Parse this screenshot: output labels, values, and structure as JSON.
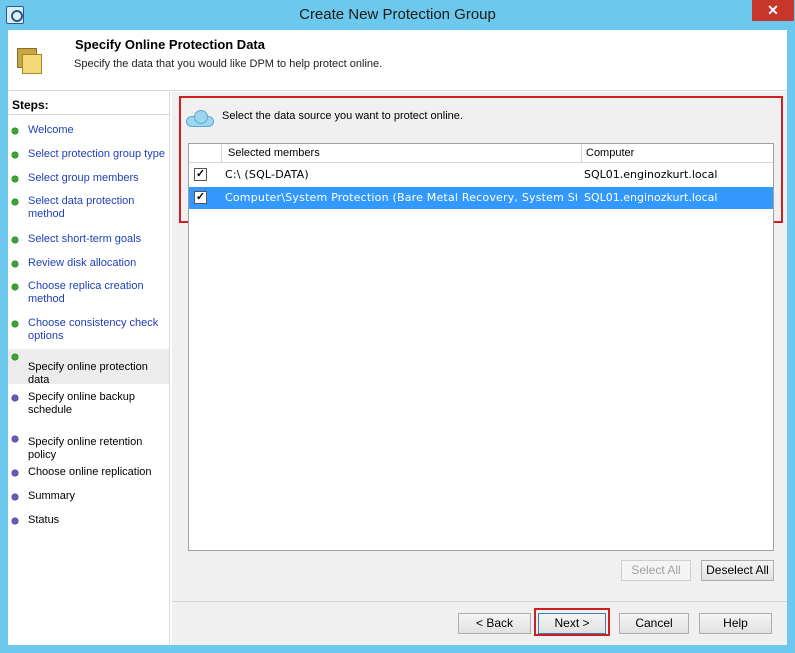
{
  "window": {
    "title": "Create New Protection Group",
    "close_glyph": "✕"
  },
  "header": {
    "title": "Specify Online Protection Data",
    "subtitle": "Specify the data that you would like DPM to help protect online."
  },
  "steps": {
    "title": "Steps:",
    "items": [
      {
        "label": "Welcome",
        "status": "complete"
      },
      {
        "label": "Select protection group type",
        "status": "complete"
      },
      {
        "label": "Select group members",
        "status": "complete"
      },
      {
        "label": "Select data protection method",
        "status": "complete"
      },
      {
        "label": "Select short-term goals",
        "status": "complete"
      },
      {
        "label": "Review disk allocation",
        "status": "complete"
      },
      {
        "label": "Choose replica creation method",
        "status": "complete"
      },
      {
        "label": "Choose consistency check options",
        "status": "complete"
      },
      {
        "label": "Specify online protection data",
        "status": "current"
      },
      {
        "label": "Specify online backup schedule",
        "status": "pending"
      },
      {
        "label": "Specify online retention policy",
        "status": "pending"
      },
      {
        "label": "Choose online replication",
        "status": "pending"
      },
      {
        "label": "Summary",
        "status": "pending"
      },
      {
        "label": "Status",
        "status": "pending"
      }
    ]
  },
  "main": {
    "instruction": "Select the data source you want to protect online.",
    "columns": {
      "members": "Selected members",
      "computer": "Computer"
    },
    "rows": [
      {
        "checked": true,
        "member": "C:\\ (SQL-DATA)",
        "computer": "SQL01.enginozkurt.local",
        "selected": false
      },
      {
        "checked": true,
        "member": "Computer\\System Protection (Bare Metal Recovery, System Sta...",
        "computer": "SQL01.enginozkurt.local",
        "selected": true
      }
    ],
    "select_all_label": "Select All",
    "deselect_all_label": "Deselect All"
  },
  "footer": {
    "back_label": "< Back",
    "next_label": "Next >",
    "cancel_label": "Cancel",
    "help_label": "Help"
  },
  "colors": {
    "titlebar": "#6cc8ec",
    "highlight": "#cc1f1f",
    "selection": "#3399ff",
    "step_complete": "#3ba52f",
    "step_pending": "#6b5ab5",
    "link": "#1f3fb5"
  },
  "icons": {
    "app": "dpm-icon",
    "header": "folders-icon",
    "instruction": "cloud-icon",
    "checkbox": "checkmark-icon"
  }
}
